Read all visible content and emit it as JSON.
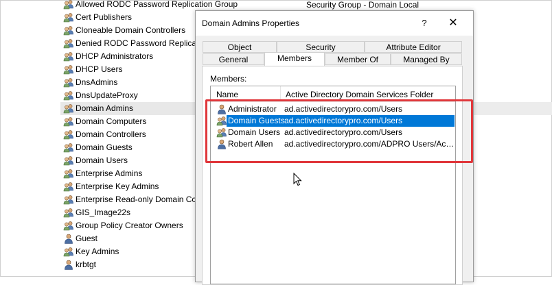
{
  "background_list": {
    "items": [
      {
        "label": "Allowed RODC Password Replication Group",
        "icon": "group-icon"
      },
      {
        "label": "Cert Publishers",
        "icon": "group-icon"
      },
      {
        "label": "Cloneable Domain Controllers",
        "icon": "group-icon"
      },
      {
        "label": "Denied RODC Password Replication Group",
        "icon": "group-icon"
      },
      {
        "label": "DHCP Administrators",
        "icon": "group-icon"
      },
      {
        "label": "DHCP Users",
        "icon": "group-icon"
      },
      {
        "label": "DnsAdmins",
        "icon": "group-icon"
      },
      {
        "label": "DnsUpdateProxy",
        "icon": "group-icon"
      },
      {
        "label": "Domain Admins",
        "icon": "group-icon"
      },
      {
        "label": "Domain Computers",
        "icon": "group-icon"
      },
      {
        "label": "Domain Controllers",
        "icon": "group-icon"
      },
      {
        "label": "Domain Guests",
        "icon": "group-icon"
      },
      {
        "label": "Domain Users",
        "icon": "group-icon"
      },
      {
        "label": "Enterprise Admins",
        "icon": "group-icon"
      },
      {
        "label": "Enterprise Key Admins",
        "icon": "group-icon"
      },
      {
        "label": "Enterprise Read-only Domain Controllers",
        "icon": "group-icon"
      },
      {
        "label": "GIS_Image22s",
        "icon": "group-icon"
      },
      {
        "label": "Group Policy Creator Owners",
        "icon": "group-icon"
      },
      {
        "label": "Guest",
        "icon": "user-icon"
      },
      {
        "label": "Key Admins",
        "icon": "group-icon"
      },
      {
        "label": "krbtgt",
        "icon": "user-icon"
      }
    ],
    "first_row_type": "Security Group - Domain Local"
  },
  "dialog": {
    "title": "Domain Admins Properties",
    "help_label": "?",
    "close_label": "✕",
    "tabs_row1": [
      "Object",
      "Security",
      "Attribute Editor"
    ],
    "tabs_row2": [
      "General",
      "Members",
      "Member Of",
      "Managed By"
    ],
    "active_tab": "Members",
    "members_label": "Members:",
    "columns": [
      "Name",
      "Active Directory Domain Services Folder"
    ],
    "members": [
      {
        "name": "Administrator",
        "folder": "ad.activedirectorypro.com/Users",
        "icon": "user-icon",
        "selected": false
      },
      {
        "name": "Domain Guests",
        "folder": "ad.activedirectorypro.com/Users",
        "icon": "group-icon",
        "selected": true
      },
      {
        "name": "Domain Users",
        "folder": "ad.activedirectorypro.com/Users",
        "icon": "group-icon",
        "selected": false
      },
      {
        "name": "Robert Allen",
        "folder": "ad.activedirectorypro.com/ADPRO Users/Accounting",
        "icon": "user-icon",
        "selected": false
      }
    ]
  },
  "colors": {
    "selection": "#0078d7",
    "annotation": "#e0373b"
  }
}
